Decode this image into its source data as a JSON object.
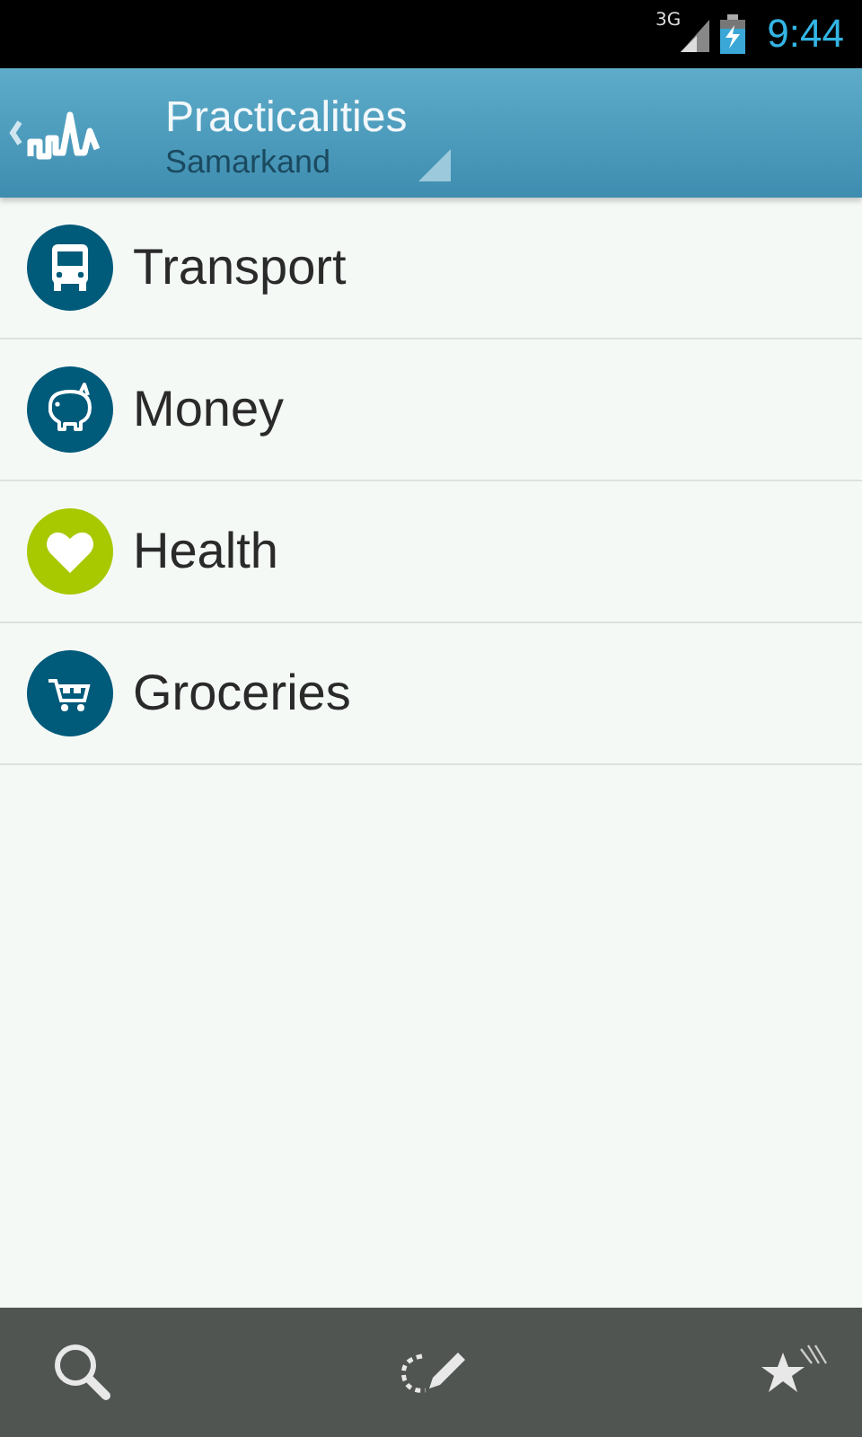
{
  "status_bar": {
    "network": "3G",
    "time": "9:44"
  },
  "header": {
    "title": "Practicalities",
    "subtitle": "Samarkand"
  },
  "items": [
    {
      "label": "Transport",
      "kind": "bus",
      "color": "#005a7a"
    },
    {
      "label": "Money",
      "kind": "piggy",
      "color": "#005a7a"
    },
    {
      "label": "Health",
      "kind": "heart",
      "color": "#a8c800"
    },
    {
      "label": "Groceries",
      "kind": "cart",
      "color": "#005a7a"
    }
  ]
}
